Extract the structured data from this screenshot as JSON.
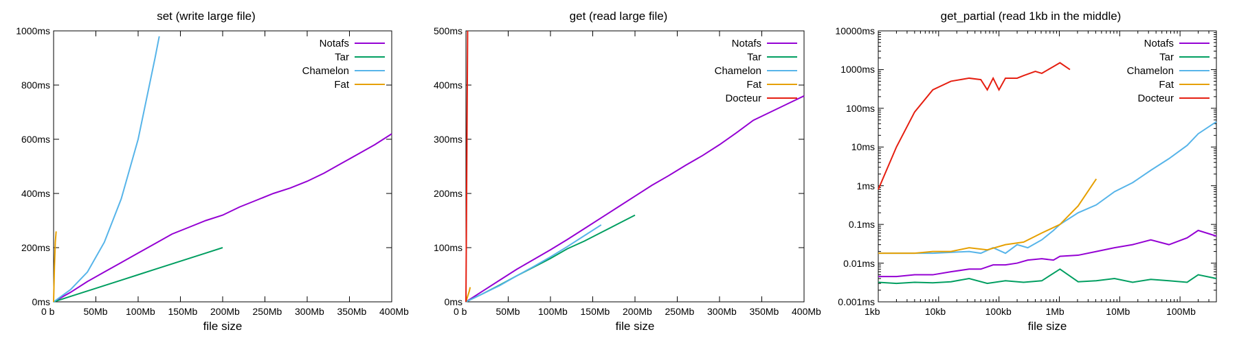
{
  "colors": {
    "notafs": "#9400d3",
    "tar": "#009e60",
    "chamelon": "#56b4e9",
    "fat": "#e69f00",
    "docteur": "#e51e10",
    "axis": "#000000"
  },
  "legend_names": {
    "notafs": "Notafs",
    "tar": "Tar",
    "chamelon": "Chamelon",
    "fat": "Fat",
    "docteur": "Docteur"
  },
  "chart_data": [
    {
      "type": "line",
      "title": "set (write large file)",
      "xlabel": "file size",
      "ylabel": "",
      "xlim": [
        0,
        400
      ],
      "ylim": [
        0,
        1000
      ],
      "x_ticks": [
        "0 b",
        "50Mb",
        "100Mb",
        "150Mb",
        "200Mb",
        "250Mb",
        "300Mb",
        "350Mb",
        "400Mb"
      ],
      "y_ticks": [
        "0ms",
        "200ms",
        "400ms",
        "600ms",
        "800ms",
        "1000ms"
      ],
      "x_unit": "Mb",
      "y_unit": "ms",
      "legend_position": "top-right",
      "series": [
        {
          "name": "Notafs",
          "x": [
            0,
            20,
            40,
            60,
            80,
            100,
            120,
            140,
            160,
            180,
            200,
            220,
            240,
            260,
            280,
            300,
            320,
            340,
            360,
            380,
            400
          ],
          "y": [
            0,
            35,
            75,
            110,
            145,
            180,
            215,
            250,
            275,
            300,
            320,
            350,
            375,
            400,
            420,
            445,
            475,
            510,
            545,
            580,
            620
          ]
        },
        {
          "name": "Tar",
          "x": [
            0,
            20,
            40,
            60,
            80,
            100,
            120,
            140,
            160,
            180,
            200
          ],
          "y": [
            0,
            20,
            40,
            60,
            80,
            100,
            120,
            140,
            160,
            180,
            200
          ]
        },
        {
          "name": "Chamelon",
          "x": [
            0,
            20,
            40,
            60,
            80,
            100,
            120,
            125
          ],
          "y": [
            0,
            45,
            110,
            220,
            380,
            600,
            900,
            980
          ]
        },
        {
          "name": "Fat",
          "x": [
            0,
            1,
            2,
            3
          ],
          "y": [
            0,
            130,
            220,
            260
          ]
        }
      ]
    },
    {
      "type": "line",
      "title": "get (read large file)",
      "xlabel": "file size",
      "ylabel": "",
      "xlim": [
        0,
        400
      ],
      "ylim": [
        0,
        500
      ],
      "x_ticks": [
        "0 b",
        "50Mb",
        "100Mb",
        "150Mb",
        "200Mb",
        "250Mb",
        "300Mb",
        "350Mb",
        "400Mb"
      ],
      "y_ticks": [
        "0ms",
        "100ms",
        "200ms",
        "300ms",
        "400ms",
        "500ms"
      ],
      "x_unit": "Mb",
      "y_unit": "ms",
      "legend_position": "top-right",
      "series": [
        {
          "name": "Notafs",
          "x": [
            0,
            20,
            40,
            60,
            80,
            100,
            120,
            140,
            160,
            180,
            200,
            220,
            240,
            260,
            280,
            300,
            320,
            340,
            360,
            380,
            400
          ],
          "y": [
            0,
            20,
            40,
            60,
            78,
            96,
            115,
            135,
            155,
            175,
            195,
            215,
            233,
            252,
            270,
            290,
            312,
            335,
            350,
            365,
            380
          ]
        },
        {
          "name": "Tar",
          "x": [
            0,
            20,
            40,
            60,
            80,
            100,
            120,
            140,
            160,
            180,
            200
          ],
          "y": [
            0,
            15,
            31,
            48,
            64,
            80,
            98,
            112,
            128,
            144,
            160
          ]
        },
        {
          "name": "Chamelon",
          "x": [
            0,
            20,
            40,
            60,
            80,
            100,
            120,
            140,
            160
          ],
          "y": [
            0,
            15,
            30,
            48,
            65,
            83,
            102,
            122,
            142
          ]
        },
        {
          "name": "Fat",
          "x": [
            0,
            2,
            4,
            5
          ],
          "y": [
            0,
            10,
            20,
            27
          ]
        },
        {
          "name": "Docteur",
          "x": [
            0,
            0.5,
            1,
            1.5,
            2
          ],
          "y": [
            0,
            120,
            250,
            380,
            500
          ]
        }
      ]
    },
    {
      "type": "line-loglog",
      "title": "get_partial (read 1kb in the middle)",
      "xlabel": "file size",
      "ylabel": "",
      "xlim_log": [
        1,
        400000
      ],
      "ylim_log": [
        0.001,
        10000
      ],
      "x_ticks": [
        "1kb",
        "10kb",
        "100kb",
        "1Mb",
        "10Mb",
        "100Mb"
      ],
      "y_ticks": [
        "0.001ms",
        "0.01ms",
        "0.1ms",
        "1ms",
        "10ms",
        "100ms",
        "1000ms",
        "10000ms"
      ],
      "x_unit": "kb",
      "y_unit": "ms",
      "legend_position": "top-right",
      "series": [
        {
          "name": "Notafs",
          "x": [
            1,
            2,
            4,
            8,
            16,
            32,
            50,
            80,
            128,
            200,
            300,
            512,
            800,
            1024,
            2048,
            4096,
            8192,
            16384,
            32768,
            65536,
            131072,
            200000,
            400000
          ],
          "y": [
            0.0045,
            0.0045,
            0.005,
            0.005,
            0.006,
            0.007,
            0.007,
            0.009,
            0.009,
            0.01,
            0.012,
            0.013,
            0.012,
            0.015,
            0.016,
            0.02,
            0.025,
            0.03,
            0.04,
            0.03,
            0.045,
            0.07,
            0.05
          ]
        },
        {
          "name": "Tar",
          "x": [
            1,
            2,
            4,
            8,
            16,
            32,
            64,
            128,
            256,
            512,
            1024,
            2048,
            4096,
            8192,
            16384,
            32768,
            65536,
            131072,
            200000,
            400000
          ],
          "y": [
            0.0032,
            0.003,
            0.0032,
            0.0031,
            0.0033,
            0.004,
            0.003,
            0.0035,
            0.0032,
            0.0035,
            0.007,
            0.0033,
            0.0035,
            0.004,
            0.0032,
            0.0038,
            0.0035,
            0.0032,
            0.005,
            0.004
          ]
        },
        {
          "name": "Chamelon",
          "x": [
            1,
            2,
            4,
            8,
            16,
            32,
            50,
            80,
            128,
            200,
            300,
            512,
            800,
            1024,
            2048,
            4096,
            8192,
            16384,
            32768,
            65536,
            131072,
            200000,
            400000
          ],
          "y": [
            0.018,
            0.018,
            0.018,
            0.018,
            0.019,
            0.02,
            0.018,
            0.025,
            0.018,
            0.03,
            0.025,
            0.04,
            0.07,
            0.1,
            0.2,
            0.32,
            0.7,
            1.2,
            2.5,
            5,
            11,
            22,
            45
          ]
        },
        {
          "name": "Fat",
          "x": [
            1,
            2,
            4,
            8,
            16,
            32,
            64,
            128,
            256,
            512,
            1024,
            2048,
            4096
          ],
          "y": [
            0.018,
            0.018,
            0.018,
            0.02,
            0.02,
            0.025,
            0.022,
            0.03,
            0.035,
            0.06,
            0.1,
            0.3,
            1.5
          ]
        },
        {
          "name": "Docteur",
          "x": [
            1,
            2,
            4,
            8,
            16,
            32,
            50,
            64,
            80,
            100,
            128,
            200,
            256,
            400,
            512,
            800,
            1024,
            1500
          ],
          "y": [
            0.8,
            10,
            80,
            300,
            500,
            600,
            550,
            300,
            600,
            300,
            600,
            600,
            700,
            900,
            800,
            1200,
            1500,
            1000
          ]
        }
      ]
    }
  ]
}
